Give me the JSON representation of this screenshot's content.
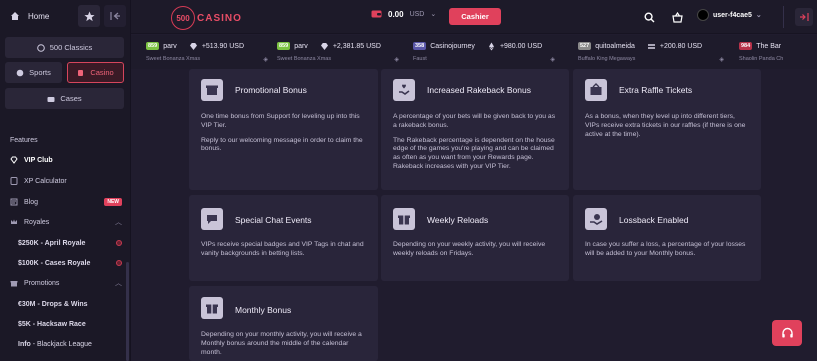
{
  "sidebar": {
    "home_label": "Home",
    "classics_label": "500 Classics",
    "sports_label": "Sports",
    "casino_label": "Casino",
    "cases_label": "Cases",
    "features_heading": "Features",
    "vip_club": "VIP Club",
    "xp_calculator": "XP Calculator",
    "blog": "Blog",
    "blog_badge": "NEW",
    "royales": "Royales",
    "royale_1": "$250K - April Royale",
    "royale_2": "$100K - Cases Royale",
    "promotions": "Promotions",
    "promo_1": "€30M - Drops & Wins",
    "promo_2": "$5K - Hacksaw Race",
    "info_prefix": "Info",
    "info_suffix": " - Blackjack League"
  },
  "topbar": {
    "logo_number": "500",
    "logo_text": "CASINO",
    "balance_amount": "0.00",
    "balance_currency": "USD",
    "cashier_label": "Cashier",
    "username": "user-f4cae5"
  },
  "ticker": [
    {
      "level": "859",
      "level_color": "#7cc243",
      "user": "parv",
      "amount": "+513.90 USD",
      "game": "Sweet Bonanza Xmas"
    },
    {
      "level": "859",
      "level_color": "#7cc243",
      "user": "parv",
      "amount": "+2,381.85 USD",
      "game": "Sweet Bonanza Xmas"
    },
    {
      "level": "358",
      "level_color": "#5a57a8",
      "user": "Casinojourney",
      "amount": "+980.00 USD",
      "game": "Faust"
    },
    {
      "level": "527",
      "level_color": "#8a8a8a",
      "user": "quitoalmeida",
      "amount": "+200.80 USD",
      "game": "Buffalo King Megaways"
    },
    {
      "level": "984",
      "level_color": "#b8324a",
      "user": "The Bar",
      "amount": "",
      "game": "Shaolin Panda Ch"
    }
  ],
  "cards": {
    "promotional_bonus": {
      "title": "Promotional Bonus",
      "p1": "One time bonus from Support for leveling up into this VIP Tier.",
      "p2": "Reply to our welcoming message in order to claim the bonus."
    },
    "rakeback": {
      "title": "Increased Rakeback Bonus",
      "p1": "A percentage of your bets will be given back to you as a rakeback bonus.",
      "p2": "The Rakeback percentage is dependent on the house edge of the games you're playing and can be claimed as often as you want from your Rewards page. Rakeback increases with your VIP Tier."
    },
    "raffle": {
      "title": "Extra Raffle Tickets",
      "p1": "As a bonus, when they level up into different tiers, VIPs receive extra tickets in our raffles (if there is one active at the time)."
    },
    "chat": {
      "title": "Special Chat Events",
      "p1": "VIPs receive special badges and VIP Tags in chat and vanity backgrounds in betting lists."
    },
    "weekly": {
      "title": "Weekly Reloads",
      "p1": "Depending on your weekly activity, you will receive weekly reloads on Fridays."
    },
    "lossback": {
      "title": "Lossback Enabled",
      "p1": "In case you suffer a loss, a percentage of your losses will be added to your Monthly bonus."
    },
    "monthly": {
      "title": "Monthly Bonus",
      "p1": "Depending on your monthly activity, you will receive a Monthly bonus around the middle of the calendar month."
    }
  },
  "colors": {
    "accent": "#e0415c",
    "background": "#201c2e",
    "card": "#29253a",
    "sidebar": "#1b1826"
  }
}
